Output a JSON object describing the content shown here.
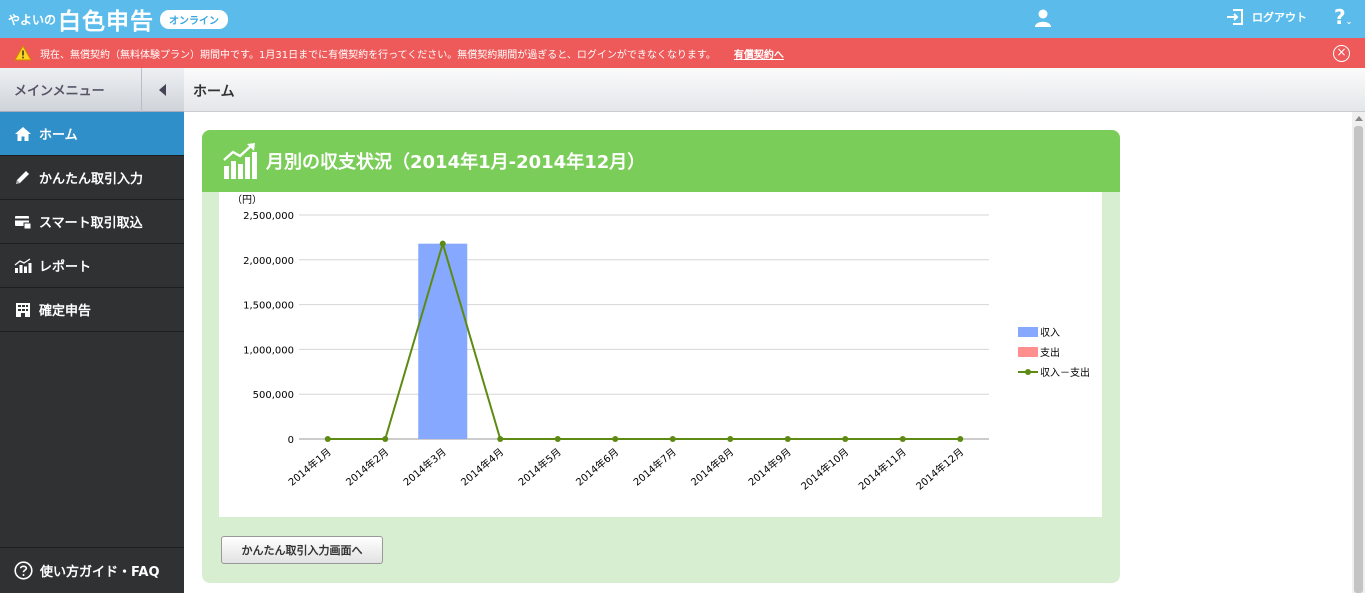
{
  "header": {
    "logo_small": "やよいの",
    "logo_main": "白色申告",
    "logo_badge": "オンライン",
    "logout_label": "ログアウト",
    "help_label": "?"
  },
  "warning": {
    "message": "現在、無償契約（無料体験プラン）期間中です。1月31日までに有償契約を行ってください。無償契約期間が過ぎると、ログインができなくなります。",
    "link_label": "有償契約へ"
  },
  "sidebar": {
    "title": "メインメニュー",
    "items": [
      {
        "label": "ホーム",
        "icon": "home-icon",
        "active": true
      },
      {
        "label": "かんたん取引入力",
        "icon": "pencil-icon",
        "active": false
      },
      {
        "label": "スマート取引取込",
        "icon": "card-icon",
        "active": false
      },
      {
        "label": "レポート",
        "icon": "report-icon",
        "active": false
      },
      {
        "label": "確定申告",
        "icon": "building-icon",
        "active": false
      }
    ],
    "guide_label": "使い方ガイド・FAQ"
  },
  "main": {
    "title": "ホーム",
    "panel_title": "月別の収支状況（2014年1月-2014年12月）",
    "button_label": "かんたん取引入力画面へ"
  },
  "colors": {
    "income": "#86a9ff",
    "expense": "#ff8f8f",
    "net": "#5d8a12"
  },
  "chart_data": {
    "type": "bar",
    "unit_label": "（円）",
    "categories": [
      "2014年1月",
      "2014年2月",
      "2014年3月",
      "2014年4月",
      "2014年5月",
      "2014年6月",
      "2014年7月",
      "2014年8月",
      "2014年9月",
      "2014年10月",
      "2014年11月",
      "2014年12月"
    ],
    "ylim": [
      0,
      2500000
    ],
    "yticks": [
      "0",
      "500,000",
      "1,000,000",
      "1,500,000",
      "2,000,000",
      "2,500,000"
    ],
    "grid": true,
    "legend_position": "right",
    "series": [
      {
        "name": "収入",
        "type": "bar",
        "values": [
          0,
          0,
          2180000,
          0,
          0,
          0,
          0,
          0,
          0,
          0,
          0,
          0
        ]
      },
      {
        "name": "支出",
        "type": "bar",
        "values": [
          0,
          0,
          0,
          0,
          0,
          0,
          0,
          0,
          0,
          0,
          0,
          0
        ]
      },
      {
        "name": "収入－支出",
        "type": "line",
        "values": [
          0,
          0,
          2180000,
          0,
          0,
          0,
          0,
          0,
          0,
          0,
          0,
          0
        ]
      }
    ]
  }
}
